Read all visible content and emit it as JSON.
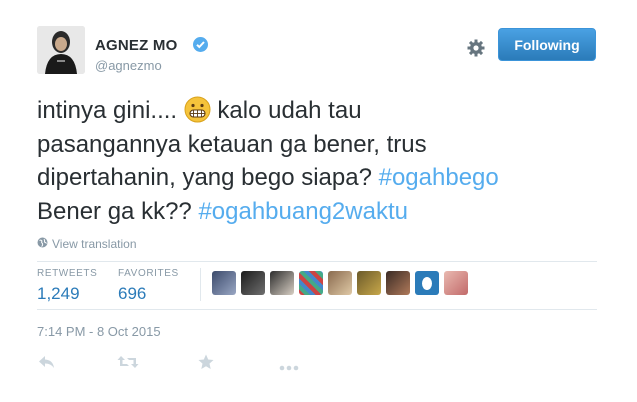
{
  "user": {
    "name": "AGNEZ MO",
    "handle": "@agnezmo",
    "verified": true
  },
  "follow_button": {
    "label": "Following"
  },
  "tweet": {
    "text_line1_a": "intinya gini.... ",
    "text_line1_b": " kalo udah tau",
    "text_line2": "pasangannya ketauan ga bener, trus",
    "text_line3": "dipertahanin, yang bego siapa? ",
    "hashtag1": "#ogahbego",
    "text_line4": "Bener ga kk?? ",
    "hashtag2": "#ogahbuang2waktu",
    "emoji": "grimacing-face"
  },
  "translate_link": "View translation",
  "stats": {
    "retweets_label": "RETWEETS",
    "retweets_value": "1,249",
    "favorites_label": "FAVORITES",
    "favorites_value": "696"
  },
  "timestamp": "7:14 PM - 8 Oct 2015",
  "actions": [
    "reply-icon",
    "retweet-icon",
    "favorite-icon",
    "more-icon"
  ],
  "colors": {
    "link": "#55acee",
    "stat": "#2b7bb9",
    "muted": "#8899a6",
    "button": "#2b7bb9"
  }
}
